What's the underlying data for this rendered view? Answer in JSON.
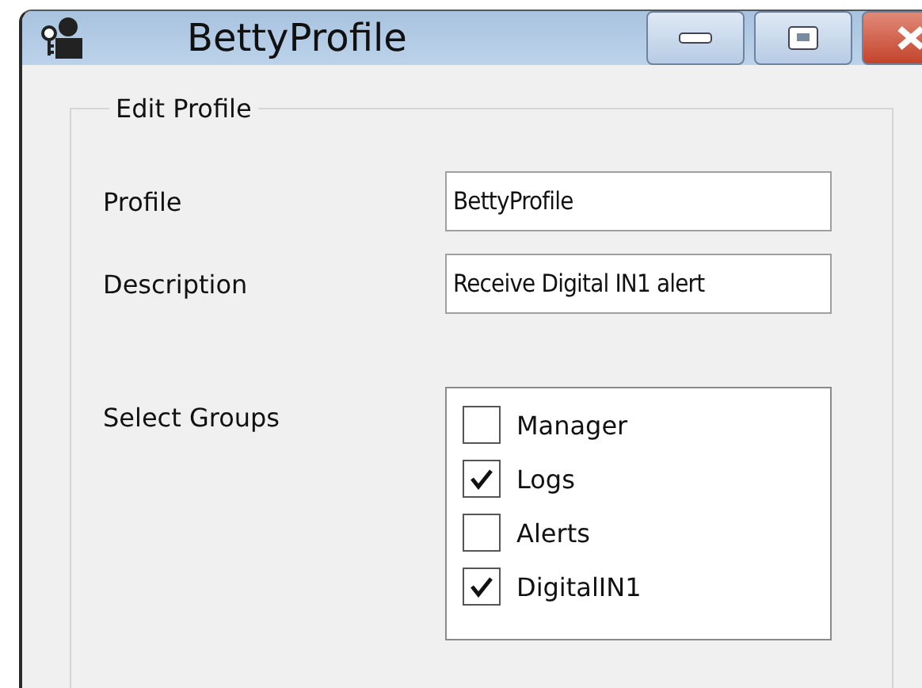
{
  "window": {
    "title": "BettyProfile"
  },
  "group": {
    "title": "Edit Profile"
  },
  "fields": [
    {
      "label": "Profile",
      "value": "BettyProfile"
    },
    {
      "label": "Description",
      "value": "Receive Digital IN1 alert"
    }
  ],
  "groups_list": {
    "label": "Select Groups",
    "items": [
      {
        "label": "Manager",
        "checked": false
      },
      {
        "label": "Logs",
        "checked": true
      },
      {
        "label": "Alerts",
        "checked": false
      },
      {
        "label": "DigitalIN1",
        "checked": true
      }
    ]
  }
}
